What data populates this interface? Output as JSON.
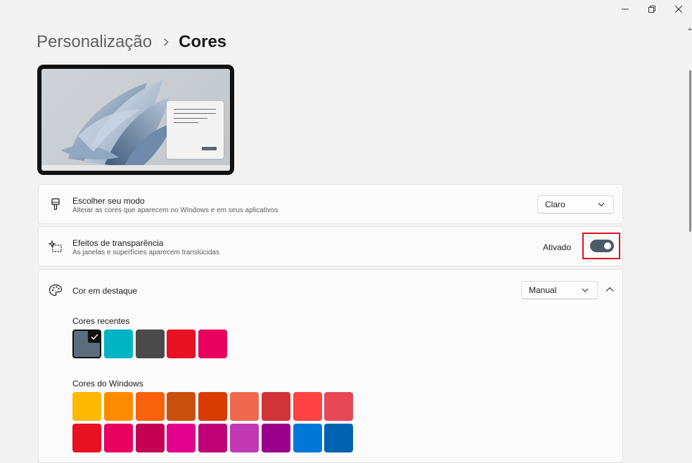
{
  "breadcrumb": {
    "parent": "Personalização",
    "current": "Cores"
  },
  "mode_card": {
    "title": "Escolher seu modo",
    "subtitle": "Alterar as cores que aparecem no Windows e em seus aplicativos",
    "dropdown_value": "Claro",
    "icon": "paintbrush-icon"
  },
  "transparency_card": {
    "title": "Efeitos de transparência",
    "subtitle": "As janelas e superfícies aparecem translúcidas",
    "status": "Ativado",
    "toggle_on": true,
    "icon": "sparkle-icon"
  },
  "accent_card": {
    "title": "Cor em destaque",
    "dropdown_value": "Manual",
    "icon": "palette-icon",
    "expanded": true,
    "recent_label": "Cores recentes",
    "recent_colors": [
      "#5b6d7d",
      "#00b4c4",
      "#4a4a4a",
      "#e81123",
      "#ea005e"
    ],
    "selected_recent_index": 0,
    "windows_label": "Cores do Windows",
    "windows_colors_row1": [
      "#ffb900",
      "#ff8c00",
      "#f7630c",
      "#ca5010",
      "#da3b01",
      "#ef6950",
      "#d13438",
      "#ff4343",
      "#e74856"
    ],
    "windows_colors_row2": [
      "#e81123",
      "#ea005e",
      "#c30052",
      "#e3008c",
      "#bf0077",
      "#c239b3",
      "#9a0089",
      "#0078d7",
      "#0063b1"
    ]
  },
  "colors": {
    "toggle_on": "#4d5c69",
    "highlight_border": "#e0101e"
  }
}
